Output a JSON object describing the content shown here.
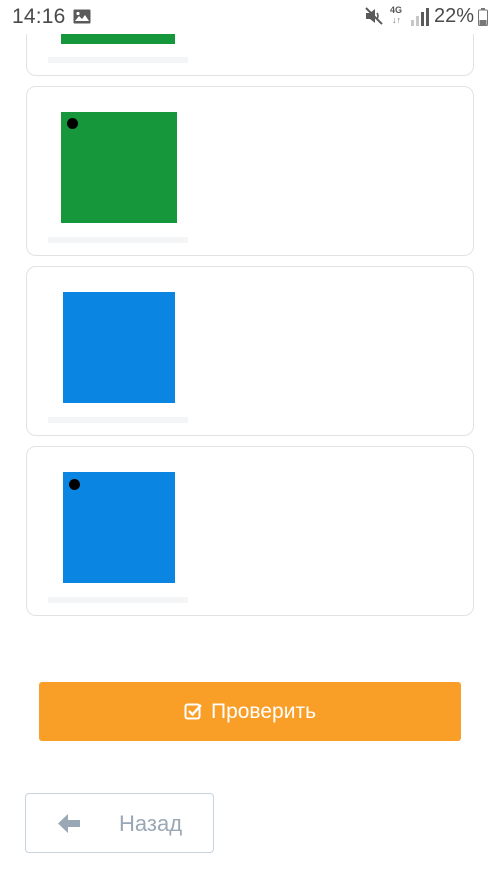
{
  "status_bar": {
    "time": "14:16",
    "network_label": "4G",
    "battery_percent": "22%",
    "icons": [
      "gallery-icon",
      "mute-icon",
      "network-4g-icon",
      "signal-icon",
      "battery-icon"
    ]
  },
  "colors": {
    "green": "#16973c",
    "blue": "#0a86e2",
    "accent_orange": "#f99e27",
    "dot": "#000000"
  },
  "options": [
    {
      "color": "green",
      "has_dot": false,
      "partially_visible": true
    },
    {
      "color": "green",
      "has_dot": true
    },
    {
      "color": "blue",
      "has_dot": false
    },
    {
      "color": "blue",
      "has_dot": true
    }
  ],
  "actions": {
    "check_label": "Проверить",
    "check_icon": "checkbox-icon",
    "back_label": "Назад",
    "back_icon": "arrow-left-icon"
  }
}
